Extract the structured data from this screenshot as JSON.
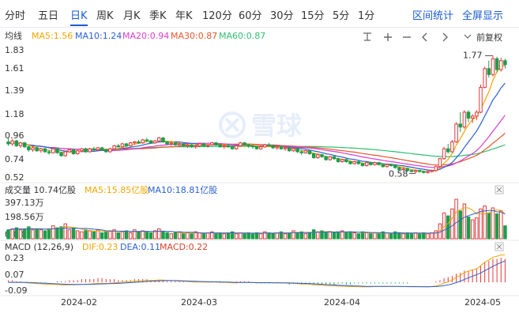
{
  "tabs": [
    {
      "label": "分时"
    },
    {
      "label": "五日"
    },
    {
      "label": "日K",
      "active": true
    },
    {
      "label": "周K"
    },
    {
      "label": "月K"
    },
    {
      "label": "季K"
    },
    {
      "label": "年K"
    },
    {
      "label": "120分"
    },
    {
      "label": "60分"
    },
    {
      "label": "30分"
    },
    {
      "label": "15分"
    },
    {
      "label": "5分"
    },
    {
      "label": "1分"
    }
  ],
  "actions": {
    "interval_stats": "区间统计",
    "fullscreen": "全屏显示"
  },
  "main_panel": {
    "label": "均线",
    "ma": [
      {
        "text": "MA5:1.56",
        "color": "#f0a500"
      },
      {
        "text": "MA10:1.24",
        "color": "#2a5fd6"
      },
      {
        "text": "MA20:0.94",
        "color": "#d63fcf"
      },
      {
        "text": "MA30:0.87",
        "color": "#e4572e"
      },
      {
        "text": "MA60:0.87",
        "color": "#2fbf71"
      }
    ],
    "adjust_label": "前复权",
    "y_ticks": [
      "1.83",
      "1.61",
      "1.39",
      "1.18",
      "0.96",
      "0.74",
      "0.52"
    ],
    "max_label": "1.77",
    "min_label": "0.58"
  },
  "volume_panel": {
    "label": "成交量 10.74亿股",
    "ma": [
      {
        "text": "MA5:15.85亿股",
        "color": "#f0a500"
      },
      {
        "text": "MA10:18.81亿股",
        "color": "#2a5fd6"
      }
    ],
    "y_ticks": [
      "397.13万",
      "198.56万",
      "0.00"
    ]
  },
  "macd_panel": {
    "label": "MACD (12,26,9)",
    "items": [
      {
        "text": "DIF:0.23",
        "color": "#f0a500"
      },
      {
        "text": "DEA:0.11",
        "color": "#2a5fd6"
      },
      {
        "text": "MACD:0.22",
        "color": "#d6452b"
      }
    ],
    "y_ticks": [
      "0.23",
      "0.07",
      "-0.09"
    ]
  },
  "x_labels": [
    "2024-02",
    "2024-03",
    "2024-04",
    "2024-05"
  ],
  "colors": {
    "up": "#e4393c",
    "down": "#1b9e4b"
  },
  "chart_data": {
    "type": "candlestick",
    "x_start": "2024-01-10",
    "x_ticks": [
      {
        "date": "2024-02",
        "index": 15
      },
      {
        "date": "2024-03",
        "index": 50
      },
      {
        "date": "2024-04",
        "index": 87
      },
      {
        "date": "2024-05",
        "index": 121
      }
    ],
    "price_ylim": [
      0.52,
      1.83
    ],
    "ohlc": [
      [
        0.9,
        0.94,
        0.86,
        0.88
      ],
      [
        0.88,
        0.93,
        0.86,
        0.91
      ],
      [
        0.91,
        0.92,
        0.85,
        0.86
      ],
      [
        0.86,
        0.9,
        0.84,
        0.89
      ],
      [
        0.89,
        0.9,
        0.84,
        0.85
      ],
      [
        0.85,
        0.86,
        0.8,
        0.82
      ],
      [
        0.82,
        0.86,
        0.8,
        0.84
      ],
      [
        0.84,
        0.85,
        0.8,
        0.81
      ],
      [
        0.81,
        0.84,
        0.79,
        0.83
      ],
      [
        0.83,
        0.84,
        0.79,
        0.8
      ],
      [
        0.8,
        0.82,
        0.77,
        0.79
      ],
      [
        0.79,
        0.84,
        0.78,
        0.83
      ],
      [
        0.83,
        0.84,
        0.78,
        0.79
      ],
      [
        0.79,
        0.8,
        0.75,
        0.76
      ],
      [
        0.76,
        0.81,
        0.75,
        0.8
      ],
      [
        0.8,
        0.83,
        0.79,
        0.82
      ],
      [
        0.82,
        0.83,
        0.77,
        0.78
      ],
      [
        0.78,
        0.82,
        0.77,
        0.81
      ],
      [
        0.81,
        0.84,
        0.8,
        0.83
      ],
      [
        0.83,
        0.84,
        0.79,
        0.8
      ],
      [
        0.8,
        0.84,
        0.79,
        0.83
      ],
      [
        0.83,
        0.85,
        0.81,
        0.82
      ],
      [
        0.82,
        0.85,
        0.81,
        0.84
      ],
      [
        0.84,
        0.85,
        0.81,
        0.82
      ],
      [
        0.82,
        0.83,
        0.79,
        0.8
      ],
      [
        0.8,
        0.84,
        0.79,
        0.83
      ],
      [
        0.83,
        0.87,
        0.82,
        0.86
      ],
      [
        0.86,
        0.88,
        0.84,
        0.85
      ],
      [
        0.85,
        0.89,
        0.84,
        0.88
      ],
      [
        0.88,
        0.89,
        0.85,
        0.86
      ],
      [
        0.86,
        0.9,
        0.85,
        0.89
      ],
      [
        0.89,
        0.91,
        0.87,
        0.9
      ],
      [
        0.9,
        0.92,
        0.88,
        0.89
      ],
      [
        0.89,
        0.93,
        0.88,
        0.92
      ],
      [
        0.92,
        0.94,
        0.9,
        0.91
      ],
      [
        0.91,
        0.92,
        0.88,
        0.89
      ],
      [
        0.89,
        0.92,
        0.88,
        0.91
      ],
      [
        0.91,
        0.95,
        0.9,
        0.94
      ],
      [
        0.94,
        0.95,
        0.89,
        0.9
      ],
      [
        0.9,
        0.91,
        0.87,
        0.88
      ],
      [
        0.88,
        0.9,
        0.86,
        0.89
      ],
      [
        0.89,
        0.9,
        0.86,
        0.87
      ],
      [
        0.87,
        0.89,
        0.85,
        0.88
      ],
      [
        0.88,
        0.89,
        0.85,
        0.86
      ],
      [
        0.86,
        0.88,
        0.84,
        0.87
      ],
      [
        0.87,
        0.88,
        0.84,
        0.85
      ],
      [
        0.85,
        0.87,
        0.83,
        0.86
      ],
      [
        0.86,
        0.89,
        0.85,
        0.88
      ],
      [
        0.88,
        0.89,
        0.85,
        0.86
      ],
      [
        0.86,
        0.88,
        0.84,
        0.87
      ],
      [
        0.87,
        0.9,
        0.86,
        0.89
      ],
      [
        0.89,
        0.9,
        0.86,
        0.87
      ],
      [
        0.87,
        0.88,
        0.84,
        0.85
      ],
      [
        0.85,
        0.87,
        0.83,
        0.86
      ],
      [
        0.86,
        0.88,
        0.84,
        0.85
      ],
      [
        0.85,
        0.86,
        0.82,
        0.83
      ],
      [
        0.83,
        0.87,
        0.82,
        0.86
      ],
      [
        0.86,
        0.9,
        0.85,
        0.89
      ],
      [
        0.89,
        0.9,
        0.86,
        0.87
      ],
      [
        0.87,
        0.88,
        0.84,
        0.86
      ],
      [
        0.86,
        0.87,
        0.83,
        0.85
      ],
      [
        0.85,
        0.86,
        0.82,
        0.83
      ],
      [
        0.83,
        0.86,
        0.82,
        0.85
      ],
      [
        0.85,
        0.88,
        0.84,
        0.87
      ],
      [
        0.87,
        0.89,
        0.85,
        0.86
      ],
      [
        0.86,
        0.87,
        0.83,
        0.84
      ],
      [
        0.84,
        0.86,
        0.82,
        0.85
      ],
      [
        0.85,
        0.86,
        0.82,
        0.83
      ],
      [
        0.83,
        0.85,
        0.81,
        0.84
      ],
      [
        0.84,
        0.85,
        0.8,
        0.81
      ],
      [
        0.81,
        0.84,
        0.8,
        0.83
      ],
      [
        0.83,
        0.84,
        0.79,
        0.8
      ],
      [
        0.8,
        0.82,
        0.77,
        0.79
      ],
      [
        0.79,
        0.82,
        0.78,
        0.81
      ],
      [
        0.81,
        0.82,
        0.77,
        0.78
      ],
      [
        0.78,
        0.79,
        0.73,
        0.74
      ],
      [
        0.74,
        0.78,
        0.73,
        0.77
      ],
      [
        0.77,
        0.78,
        0.74,
        0.75
      ],
      [
        0.75,
        0.76,
        0.71,
        0.72
      ],
      [
        0.72,
        0.76,
        0.71,
        0.75
      ],
      [
        0.75,
        0.76,
        0.72,
        0.73
      ],
      [
        0.73,
        0.74,
        0.69,
        0.7
      ],
      [
        0.7,
        0.73,
        0.69,
        0.72
      ],
      [
        0.72,
        0.73,
        0.69,
        0.7
      ],
      [
        0.7,
        0.71,
        0.67,
        0.68
      ],
      [
        0.68,
        0.71,
        0.67,
        0.7
      ],
      [
        0.7,
        0.71,
        0.67,
        0.68
      ],
      [
        0.68,
        0.69,
        0.65,
        0.66
      ],
      [
        0.66,
        0.7,
        0.65,
        0.69
      ],
      [
        0.69,
        0.7,
        0.66,
        0.67
      ],
      [
        0.67,
        0.7,
        0.66,
        0.69
      ],
      [
        0.69,
        0.7,
        0.66,
        0.67
      ],
      [
        0.67,
        0.68,
        0.64,
        0.65
      ],
      [
        0.65,
        0.68,
        0.64,
        0.67
      ],
      [
        0.67,
        0.68,
        0.65,
        0.66
      ],
      [
        0.66,
        0.67,
        0.63,
        0.64
      ],
      [
        0.64,
        0.65,
        0.61,
        0.62
      ],
      [
        0.62,
        0.64,
        0.61,
        0.63
      ],
      [
        0.63,
        0.64,
        0.6,
        0.61
      ],
      [
        0.61,
        0.62,
        0.59,
        0.6
      ],
      [
        0.6,
        0.62,
        0.58,
        0.61
      ],
      [
        0.61,
        0.62,
        0.59,
        0.6
      ],
      [
        0.6,
        0.61,
        0.58,
        0.59
      ],
      [
        0.59,
        0.61,
        0.58,
        0.6
      ],
      [
        0.6,
        0.62,
        0.59,
        0.61
      ],
      [
        0.61,
        0.66,
        0.6,
        0.65
      ],
      [
        0.65,
        0.74,
        0.64,
        0.73
      ],
      [
        0.73,
        0.85,
        0.72,
        0.83
      ],
      [
        0.83,
        0.88,
        0.78,
        0.8
      ],
      [
        0.8,
        0.92,
        0.79,
        0.9
      ],
      [
        0.9,
        1.1,
        0.89,
        1.08
      ],
      [
        1.08,
        1.2,
        1.0,
        1.05
      ],
      [
        1.05,
        1.22,
        1.03,
        1.2
      ],
      [
        1.2,
        1.22,
        1.1,
        1.14
      ],
      [
        1.14,
        1.18,
        1.09,
        1.16
      ],
      [
        1.16,
        1.22,
        1.12,
        1.2
      ],
      [
        1.2,
        1.48,
        1.19,
        1.45
      ],
      [
        1.45,
        1.66,
        1.44,
        1.64
      ],
      [
        1.64,
        1.72,
        1.55,
        1.58
      ],
      [
        1.58,
        1.77,
        1.56,
        1.74
      ],
      [
        1.74,
        1.76,
        1.6,
        1.63
      ],
      [
        1.63,
        1.75,
        1.61,
        1.72
      ],
      [
        1.72,
        1.74,
        1.64,
        1.68
      ]
    ],
    "volume_ylim": [
      0,
      3971300
    ],
    "volume": [
      900000,
      1000000,
      1100000,
      900000,
      1000000,
      1200000,
      900000,
      1000000,
      900000,
      800000,
      1000000,
      1300000,
      1100000,
      1200000,
      1500000,
      900000,
      1000000,
      800000,
      700000,
      900000,
      800000,
      700000,
      900000,
      600000,
      700000,
      800000,
      900000,
      600000,
      700000,
      800000,
      600000,
      900000,
      700000,
      800000,
      700000,
      600000,
      800000,
      1000000,
      700000,
      600000,
      500000,
      600000,
      700000,
      500000,
      600000,
      500000,
      700000,
      600000,
      500000,
      600000,
      700000,
      500000,
      600000,
      500000,
      600000,
      700000,
      500000,
      600000,
      500000,
      600000,
      500000,
      600000,
      500000,
      700000,
      600000,
      500000,
      600000,
      700000,
      500000,
      600000,
      800000,
      600000,
      700000,
      500000,
      600000,
      900000,
      700000,
      800000,
      600000,
      700000,
      600000,
      700000,
      800000,
      600000,
      700000,
      600000,
      500000,
      700000,
      600000,
      500000,
      600000,
      500000,
      700000,
      600000,
      500000,
      700000,
      600000,
      500000,
      600000,
      500000,
      600000,
      500000,
      600000,
      500000,
      600000,
      800000,
      1500000,
      2600000,
      2300000,
      3000000,
      3971300,
      2800000,
      3500000,
      2200000,
      1900000,
      2100000,
      3000000,
      3300000,
      2600000,
      3100000,
      2500000,
      2800000,
      1300000
    ],
    "macd_ylim": [
      -0.11,
      0.26
    ],
    "macd_hist": [
      0.02,
      0.02,
      0.01,
      0.01,
      0.0,
      -0.01,
      -0.01,
      -0.01,
      -0.01,
      -0.01,
      0.0,
      0.0,
      0.01,
      0.01,
      0.01,
      0.02,
      0.02,
      0.02,
      0.03,
      0.03,
      0.03,
      0.03,
      0.04,
      0.04,
      0.03,
      0.03,
      0.03,
      0.02,
      0.02,
      0.02,
      0.02,
      0.03,
      0.03,
      0.03,
      0.03,
      0.02,
      0.02,
      0.02,
      0.02,
      0.01,
      0.01,
      0.01,
      0.01,
      0.01,
      0.0,
      0.0,
      0.01,
      0.01,
      0.01,
      0.01,
      0.01,
      0.01,
      0.01,
      0.0,
      0.0,
      0.0,
      0.01,
      0.01,
      0.01,
      0.01,
      0.0,
      -0.01,
      -0.01,
      -0.01,
      -0.01,
      0.0,
      -0.01,
      -0.01,
      -0.01,
      -0.02,
      -0.01,
      -0.01,
      -0.02,
      -0.02,
      -0.02,
      -0.02,
      -0.02,
      -0.02,
      -0.02,
      -0.02,
      -0.02,
      -0.01,
      -0.01,
      -0.02,
      -0.02,
      -0.01,
      -0.01,
      -0.01,
      -0.01,
      -0.01,
      -0.01,
      -0.01,
      -0.01,
      -0.01,
      -0.01,
      -0.01,
      -0.01,
      -0.01,
      -0.01,
      0.0,
      0.0,
      0.0,
      0.0,
      0.0,
      0.0,
      0.01,
      0.02,
      0.04,
      0.05,
      0.06,
      0.08,
      0.09,
      0.11,
      0.11,
      0.12,
      0.13,
      0.16,
      0.19,
      0.2,
      0.22,
      0.22,
      0.23,
      0.22
    ]
  }
}
